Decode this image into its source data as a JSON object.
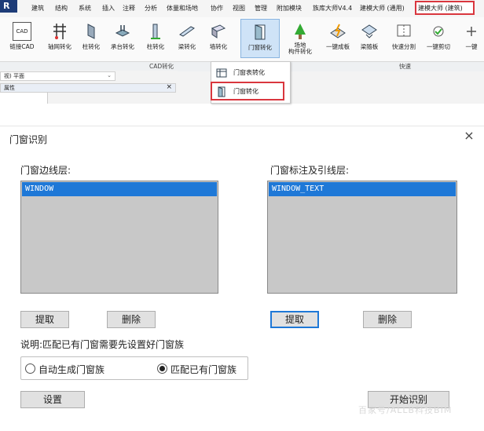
{
  "ribbon": {
    "menu": [
      "建筑",
      "结构",
      "系统",
      "插入",
      "注释",
      "分析",
      "体量和场地",
      "协作",
      "视图",
      "管理",
      "附加模块",
      "族库大师V4.4",
      "建模大师 (通用)",
      "建模大师 (建筑)"
    ],
    "commands": [
      "链接CAD",
      "轴网转化",
      "柱转化",
      "承台转化",
      "柱转化",
      "梁转化",
      "墙转化",
      "门窗转化",
      "场地\n构件转化",
      "一键成板",
      "梁随板",
      "快速分割",
      "一键剪切",
      "一键"
    ],
    "cad_icon_text": "CAD",
    "groups": {
      "cad": "CAD转化",
      "quick": "快速"
    },
    "view_combo": "视) 平面",
    "properties_title": "属性",
    "dropdown": [
      "门窗表转化",
      "门窗转化"
    ]
  },
  "dialog": {
    "title": "门窗识别",
    "close": "×",
    "left_group": {
      "heading": "门窗边线层:",
      "items": [
        "WINDOW"
      ],
      "extract": "提取",
      "delete": "删除"
    },
    "right_group": {
      "heading": "门窗标注及引线层:",
      "items": [
        "WINDOW_TEXT"
      ],
      "extract": "提取",
      "delete": "删除"
    },
    "note": "说明:匹配已有门窗需要先设置好门窗族",
    "radios": [
      {
        "label": "自动生成门窗族",
        "selected": false
      },
      {
        "label": "匹配已有门窗族",
        "selected": true
      }
    ],
    "settings": "设置",
    "start": "开始识别"
  },
  "watermark": "百家号/ALLB科技BIM",
  "colors": {
    "highlight": "#d9363e",
    "selection": "#1e78d7",
    "list_bg": "#c8c8c8"
  }
}
